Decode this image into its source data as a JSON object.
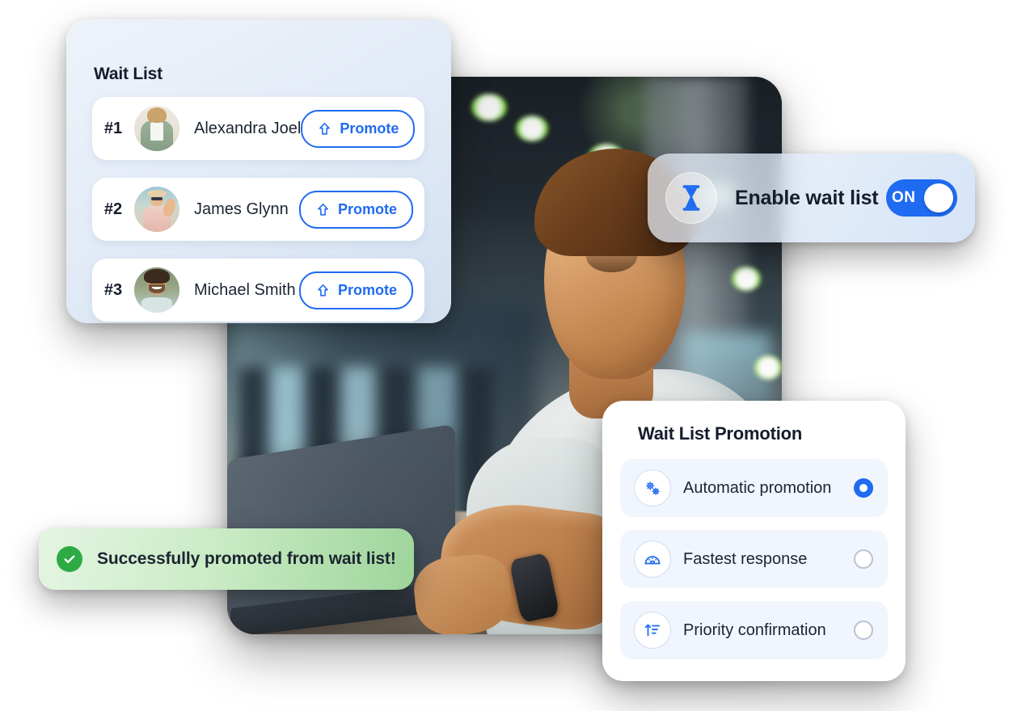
{
  "waitlist": {
    "title": "Wait List",
    "rows": [
      {
        "rank": "#1",
        "name": "Alexandra Joel",
        "action": "Promote",
        "avatar": "avatar-alexandra-joel"
      },
      {
        "rank": "#2",
        "name": "James Glynn",
        "action": "Promote",
        "avatar": "avatar-james-glynn"
      },
      {
        "rank": "#3",
        "name": "Michael Smith",
        "action": "Promote",
        "avatar": "avatar-michael-smith"
      }
    ]
  },
  "enable_toggle": {
    "icon": "hourglass-icon",
    "label": "Enable wait list",
    "state_label": "ON",
    "state": "on"
  },
  "promotion": {
    "title": "Wait List Promotion",
    "options": [
      {
        "label": "Automatic promotion",
        "icon": "gears-icon",
        "selected": true
      },
      {
        "label": "Fastest response",
        "icon": "speedometer-icon",
        "selected": false
      },
      {
        "label": "Priority confirmation",
        "icon": "sort-ascending-icon",
        "selected": false
      }
    ]
  },
  "toast": {
    "icon": "check-circle-icon",
    "message": "Successfully promoted from wait list!"
  },
  "photo": {
    "alt": "smiling man using laptop at a gym"
  },
  "colors": {
    "accent": "#1f6bf2",
    "toast_green": "#2eaa44",
    "text_dark": "#141c2b",
    "option_bg": "#f1f5fd"
  }
}
